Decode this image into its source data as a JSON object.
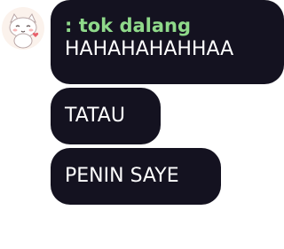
{
  "messages": [
    {
      "sender": ": tok dalang",
      "text": "HAHAHAHAHHAA"
    },
    {
      "text": "TATAU"
    },
    {
      "text": "PENIN SAYE"
    }
  ],
  "avatar": {
    "icon": "cat-sticker-avatar",
    "background": "#fbf2ec"
  },
  "colors": {
    "bubble": "#141220",
    "sender": "#8fd98a",
    "message_text": "#ffffff"
  }
}
